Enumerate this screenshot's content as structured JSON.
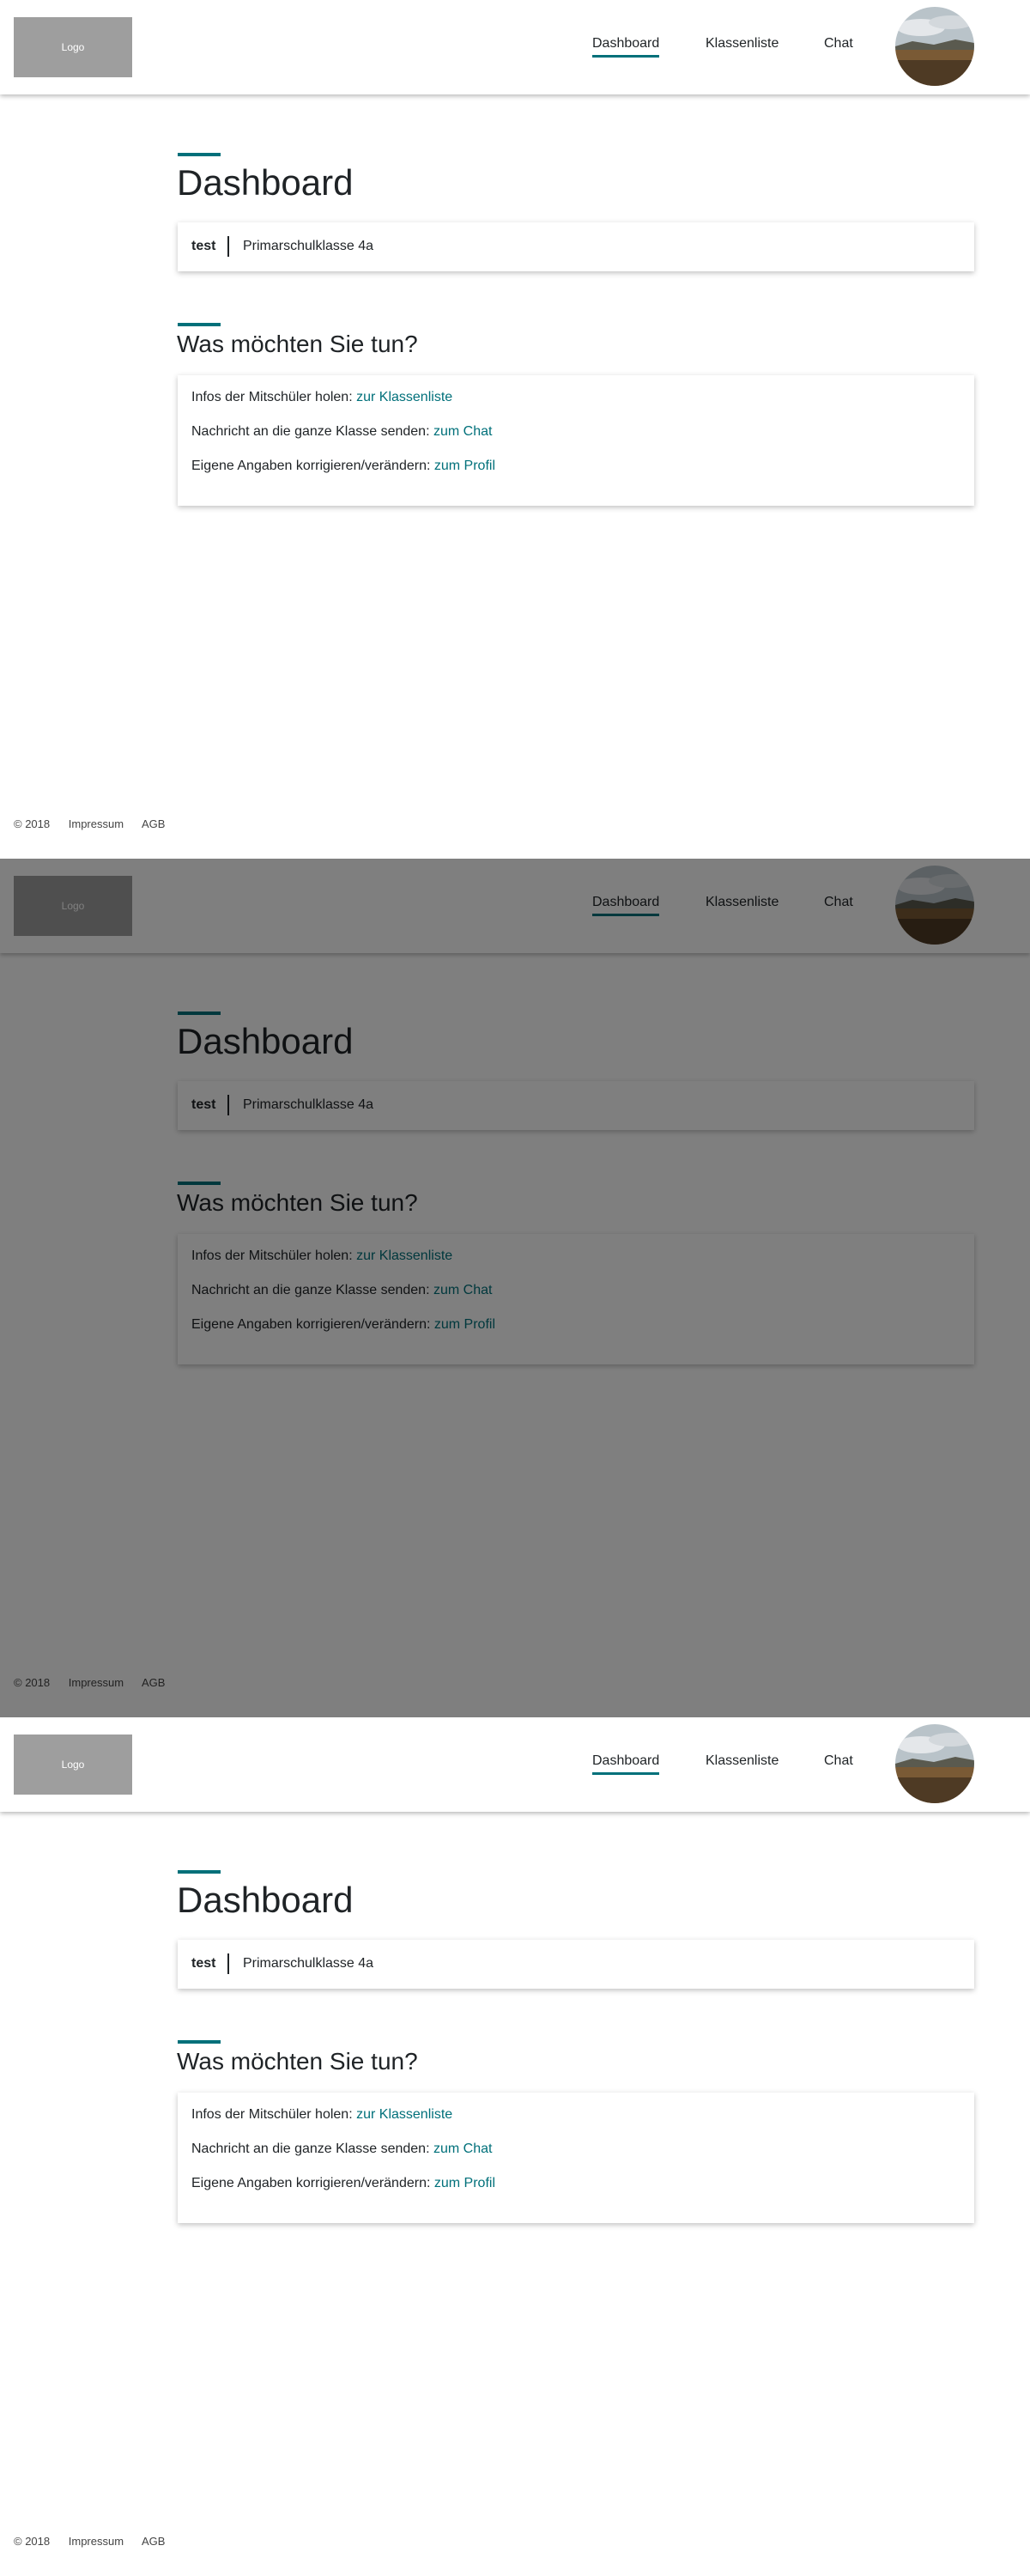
{
  "header": {
    "logo_text": "Logo",
    "nav": [
      {
        "label": "Dashboard",
        "active": true
      },
      {
        "label": "Klassenliste",
        "active": false
      },
      {
        "label": "Chat",
        "active": false
      }
    ],
    "avatar_icon": "profile-landscape-photo"
  },
  "main": {
    "title": "Dashboard",
    "user_info": {
      "name": "test",
      "class_name": "Primarschulklasse 4a"
    },
    "actions_title": "Was möchten Sie tun?",
    "actions": [
      {
        "text": "Infos der Mitschüler holen:",
        "link": "zur Klassenliste"
      },
      {
        "text": "Nachricht an die ganze Klasse senden:",
        "link": "zum Chat"
      },
      {
        "text": "Eigene Angaben korrigieren/verändern:",
        "link": "zum Profil"
      }
    ]
  },
  "footer": {
    "copyright": "© 2018",
    "links": [
      "Impressum",
      "AGB"
    ]
  },
  "colors": {
    "accent": "#00707a",
    "logo_bg": "#9e9e9e",
    "overlay": "rgba(0,0,0,0.5)"
  }
}
